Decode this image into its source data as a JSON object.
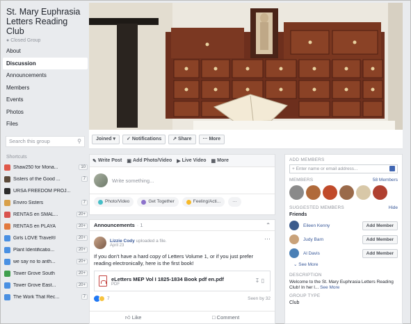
{
  "sidebar": {
    "group_title": "St. Mary Euphrasia Letters Reading Club",
    "privacy": "Closed Group",
    "nav": [
      {
        "label": "About",
        "active": false
      },
      {
        "label": "Discussion",
        "active": true
      },
      {
        "label": "Announcements",
        "active": false
      },
      {
        "label": "Members",
        "active": false
      },
      {
        "label": "Events",
        "active": false
      },
      {
        "label": "Photos",
        "active": false
      },
      {
        "label": "Files",
        "active": false
      }
    ],
    "search_placeholder": "Search this group",
    "shortcuts_title": "Shortcuts",
    "shortcuts": [
      {
        "label": "Shaw250 for Mona...",
        "count": "10",
        "color": "#e0584a"
      },
      {
        "label": "Sisters of the Good ...",
        "count": "7",
        "color": "#5b4a3a"
      },
      {
        "label": "URSA FREEDOM PROJ...",
        "count": "",
        "color": "#2b2b2b"
      },
      {
        "label": "Enviro Sisters",
        "count": "7",
        "color": "#d8a04a"
      },
      {
        "label": "RENTAS en SMAL...",
        "count": "20+",
        "color": "#d9534f"
      },
      {
        "label": "RENTAS en PLAYA",
        "count": "20+",
        "color": "#e27a3f"
      },
      {
        "label": "Girls LOVE Travel®",
        "count": "20+",
        "color": "#4a90e2"
      },
      {
        "label": "Plant Identificatio...",
        "count": "20+",
        "color": "#4a90e2"
      },
      {
        "label": "we say no to anth...",
        "count": "20+",
        "color": "#4a90e2"
      },
      {
        "label": "Tower Grove South",
        "count": "20+",
        "color": "#3f9e4d"
      },
      {
        "label": "Tower Grove East...",
        "count": "20+",
        "color": "#4a90e2"
      },
      {
        "label": "The Work That Rec...",
        "count": "7",
        "color": "#4a90e2"
      }
    ]
  },
  "actions": {
    "joined": "Joined ▾",
    "notifications": "✓ Notifications",
    "share": "↗ Share",
    "more": "··· More"
  },
  "composer": {
    "tabs": [
      "Write Post",
      "Add Photo/Video",
      "Live Video",
      "More"
    ],
    "placeholder": "Write something...",
    "chips": [
      "Photo/Video",
      "Get Together",
      "Feeling/Acti...",
      "···"
    ]
  },
  "post": {
    "section_title": "Announcements",
    "section_count": "· 1",
    "author": "Lizzie Cody",
    "author_action": "uploaded a file.",
    "date": "April 23",
    "text": "If you don't have a hard copy of Letters Volume 1, or if you just prefer reading electronically, here is the first book!",
    "file_name": "eLetters MEP Vol I 1825-1834 Book pdf en.pdf",
    "file_type": "PDF",
    "reactions_count": "7",
    "seen_by": "Seen by 32",
    "like_label": "Like",
    "comment_label": "Comment"
  },
  "right": {
    "add_members_label": "ADD MEMBERS",
    "add_members_placeholder": "+ Enter name or email address...",
    "members_label": "MEMBERS",
    "members_count": "58 Members",
    "suggested_label": "SUGGESTED MEMBERS",
    "hide_label": "Hide",
    "friends_label": "Friends",
    "suggested": [
      {
        "name": "Eileen Kenny",
        "button": "Add Member",
        "color": "#3b5b8c"
      },
      {
        "name": "Judy Barn",
        "button": "Add Member",
        "color": "#c9a27a"
      },
      {
        "name": "Al Davis",
        "button": "Add Member",
        "color": "#4a7fb5"
      }
    ],
    "see_more": "See More",
    "description_label": "DESCRIPTION",
    "description": "Welcome to the St. Mary Euphrasia Letters Reading Club! In her l...",
    "description_more": "See More",
    "group_type_label": "GROUP TYPE",
    "group_type": "Club"
  }
}
